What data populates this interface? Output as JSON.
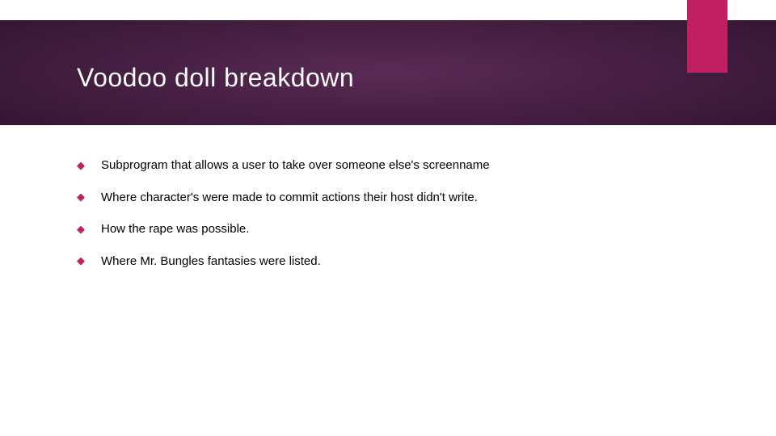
{
  "slide": {
    "title": "Voodoo doll breakdown",
    "bullets": [
      "Subprogram that allows a user to take over someone else's screenname",
      "Where character's were made to commit actions their host didn't write.",
      "How the rape was possible.",
      "Where Mr. Bungles fantasies were listed."
    ]
  }
}
